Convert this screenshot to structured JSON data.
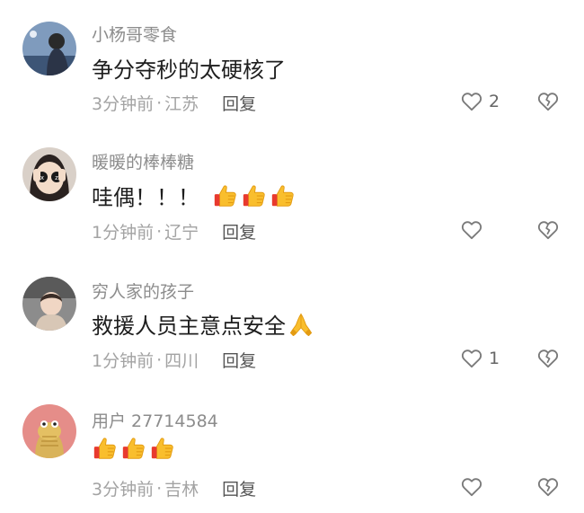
{
  "comments": [
    {
      "username": "小杨哥零食",
      "text": "争分夺秒的太硬核了",
      "time": "3分钟前",
      "location": "江苏",
      "reply_label": "回复",
      "likes": "2",
      "emoji": []
    },
    {
      "username": "暖暖的棒棒糖",
      "text": "哇偶！！！",
      "time": "1分钟前",
      "location": "辽宁",
      "reply_label": "回复",
      "likes": "",
      "emoji": [
        "thumbs-up",
        "thumbs-up",
        "thumbs-up"
      ]
    },
    {
      "username": "穷人家的孩子",
      "text": "救援人员主意点安全",
      "time": "1分钟前",
      "location": "四川",
      "reply_label": "回复",
      "likes": "1",
      "emoji": [
        "folded-hands"
      ]
    },
    {
      "username": "用户 27714584",
      "text": "",
      "time": "3分钟前",
      "location": "吉林",
      "reply_label": "回复",
      "likes": "",
      "emoji": [
        "thumbs-up",
        "thumbs-up",
        "thumbs-up"
      ]
    }
  ],
  "meta_separator": "·",
  "icons": {
    "like": "heart-outline-icon",
    "dislike": "broken-heart-icon",
    "thumbs": "thumbs-up-emoji",
    "pray": "folded-hands-emoji"
  },
  "colors": {
    "username": "#8c8c8c",
    "meta": "#a3a3a3",
    "emoji": "#f7b731"
  }
}
